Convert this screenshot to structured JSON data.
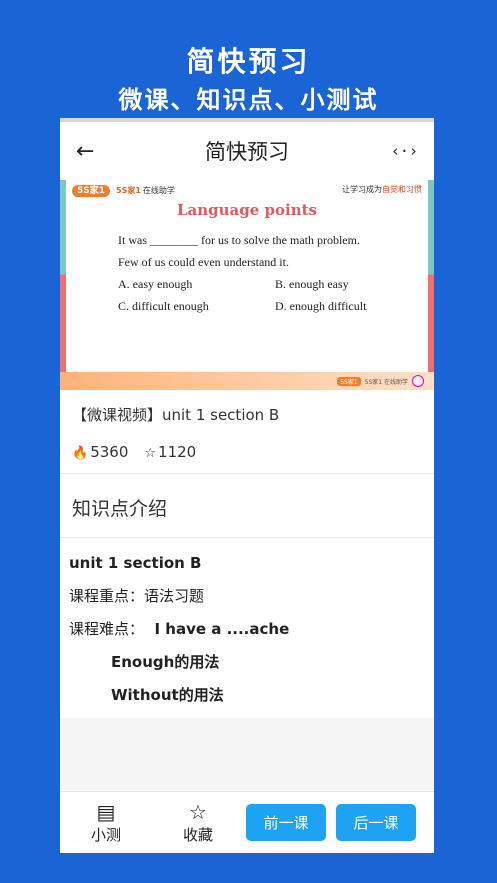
{
  "promo": {
    "title": "简快预习",
    "subtitle": "微课、知识点、小测试"
  },
  "appbar": {
    "back_icon": "←",
    "title": "简快预习",
    "share_icon": "‹·›"
  },
  "video": {
    "logo": "5S家1",
    "brand": "5S家1",
    "brand_sub": "在线助学",
    "tagline_prefix": "让学习成为",
    "tagline_highlight": "自觉和习惯",
    "slide_title": "Language points",
    "sentence1": "It was ________ for us to solve the math problem.",
    "sentence2": "Few of us could even understand it.",
    "options": [
      "A. easy enough",
      "B. enough easy",
      "C. difficult enough",
      "D. enough difficult"
    ],
    "footer_logo": "5S家1",
    "footer_brand": "5S家1 在线助学"
  },
  "info": {
    "title": "【微课视频】unit 1 section B",
    "likes": "5360",
    "favorites": "1120",
    "fire_icon": "🔥",
    "star_icon": "☆"
  },
  "knowledge": {
    "header": "知识点介绍",
    "unit": "unit 1 section B",
    "focus_label": "课程重点：",
    "focus_value": "语法习题",
    "difficulty_label": "课程难点：",
    "difficulty_value": "I have a ....ache",
    "point1": "Enough的用法",
    "point2": "Without的用法"
  },
  "bottombar": {
    "quiz_icon": "▤",
    "quiz_label": "小测",
    "collect_icon": "☆",
    "collect_label": "收藏",
    "prev_label": "前一课",
    "next_label": "后一课"
  },
  "colors": {
    "background": "#1a64d6",
    "button": "#1ea2f3"
  }
}
